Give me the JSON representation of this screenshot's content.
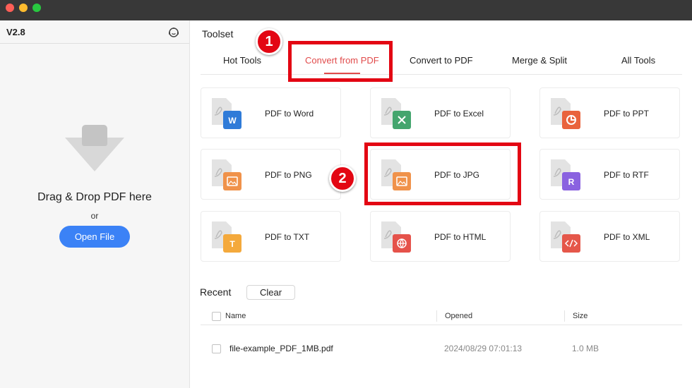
{
  "sidebar": {
    "version": "V2.8",
    "drop_text": "Drag & Drop PDF here",
    "or_text": "or",
    "open_button": "Open File"
  },
  "toolset": {
    "title": "Toolset",
    "tabs": [
      {
        "label": "Hot Tools"
      },
      {
        "label": "Convert from PDF",
        "active": true
      },
      {
        "label": "Convert to PDF"
      },
      {
        "label": "Merge & Split"
      },
      {
        "label": "All Tools"
      }
    ],
    "tools": [
      {
        "label": "PDF to Word",
        "icon": "word-file-icon",
        "color": "#2f7bd8"
      },
      {
        "label": "PDF to Excel",
        "icon": "excel-file-icon",
        "color": "#44a56e"
      },
      {
        "label": "PDF to PPT",
        "icon": "ppt-file-icon",
        "color": "#e9633d"
      },
      {
        "label": "PDF to PNG",
        "icon": "png-file-icon",
        "color": "#f0924a"
      },
      {
        "label": "PDF to JPG",
        "icon": "jpg-file-icon",
        "color": "#f0924a"
      },
      {
        "label": "PDF to RTF",
        "icon": "rtf-file-icon",
        "color": "#8a62e0"
      },
      {
        "label": "PDF to TXT",
        "icon": "txt-file-icon",
        "color": "#f4a93c"
      },
      {
        "label": "PDF to HTML",
        "icon": "html-file-icon",
        "color": "#e5524a"
      },
      {
        "label": "PDF to XML",
        "icon": "xml-file-icon",
        "color": "#e5574a"
      }
    ]
  },
  "annotations": {
    "step1": "1",
    "step2": "2"
  },
  "recent": {
    "title": "Recent",
    "clear_button": "Clear",
    "columns": {
      "name": "Name",
      "opened": "Opened",
      "size": "Size"
    },
    "rows": [
      {
        "name": "file-example_PDF_1MB.pdf",
        "opened": "2024/08/29 07:01:13",
        "size": "1.0 MB"
      }
    ]
  },
  "colors": {
    "accent": "#e14b4b",
    "primary_button": "#3b82f6",
    "highlight": "#e30613"
  }
}
